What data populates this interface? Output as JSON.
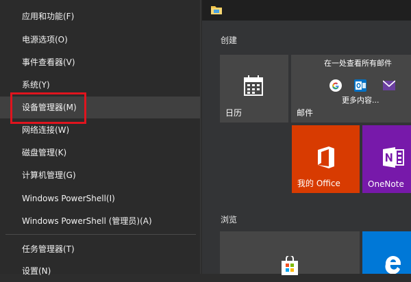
{
  "context_menu": {
    "items": [
      {
        "label": "应用和功能(F)"
      },
      {
        "label": "电源选项(O)"
      },
      {
        "label": "事件查看器(V)"
      },
      {
        "label": "系统(Y)"
      },
      {
        "label": "设备管理器(M)"
      },
      {
        "label": "网络连接(W)"
      },
      {
        "label": "磁盘管理(K)"
      },
      {
        "label": "计算机管理(G)"
      },
      {
        "label": "Windows PowerShell(I)"
      },
      {
        "label": "Windows PowerShell (管理员)(A)"
      },
      {
        "label": "任务管理器(T)"
      },
      {
        "label": "设置(N)"
      }
    ],
    "highlighted_item": "设备管理器(M)",
    "highlight_color": "#e0141e"
  },
  "start": {
    "groups": [
      {
        "title": "创建"
      },
      {
        "title": "浏览"
      }
    ],
    "tiles": {
      "calendar": {
        "label": "日历",
        "icon": "calendar-icon",
        "color": "#464646"
      },
      "mail": {
        "label": "邮件",
        "caption": "在一处查看所有邮件",
        "more": "更多内容...",
        "icons": [
          "google-icon",
          "outlook-icon",
          "mail-envelope-icon"
        ],
        "color": "#464646"
      },
      "office": {
        "label": "我的 Office",
        "icon": "office-icon",
        "color": "#d83b01"
      },
      "onenote": {
        "label": "OneNote",
        "icon": "onenote-icon",
        "color": "#7719aa"
      },
      "store": {
        "label": "",
        "icon": "store-icon",
        "color": "#464646"
      },
      "edge": {
        "label": "",
        "icon": "edge-icon",
        "color": "#0078d7"
      }
    },
    "topbar_icon": "folder-icon"
  }
}
